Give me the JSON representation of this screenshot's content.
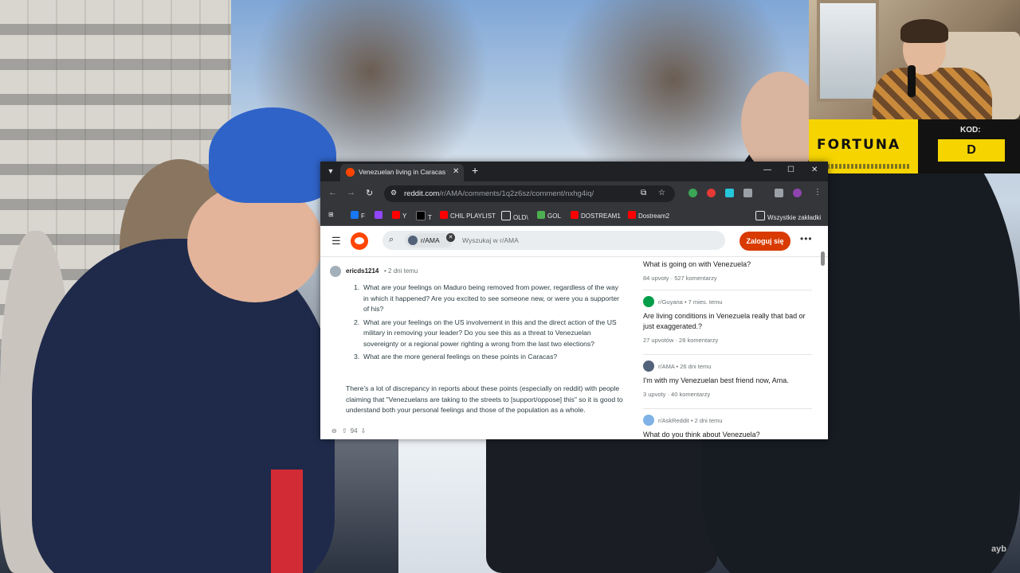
{
  "browser": {
    "tab_title": "Venezuelan living in Caracas th",
    "url_domain": "reddit.com",
    "url_path": "/r/AMA/comments/1q2z6sz/comment/nxhg4iq/",
    "bookmarks": [
      {
        "label": "F",
        "color": "#1877f2"
      },
      {
        "label": "",
        "color": "#9146ff"
      },
      {
        "label": "Y",
        "color": "#ff0000"
      },
      {
        "label": "T",
        "color": "#000000"
      },
      {
        "label": "CHIL PLAYLIST",
        "color": "#ff0000"
      },
      {
        "label": "OLD\\",
        "color": "#e8eaed"
      },
      {
        "label": "GOL",
        "color": "#4caf50"
      },
      {
        "label": "DOSTREAM1",
        "color": "#ff0000"
      },
      {
        "label": "Dostream2",
        "color": "#ff0000"
      }
    ],
    "all_bookmarks": "Wszystkie zakładki"
  },
  "reddit": {
    "subreddit_chip": "r/AMA",
    "search_placeholder": "Wyszukaj w r/AMA",
    "login_label": "Zaloguj się",
    "comment": {
      "author": "ericds1214",
      "time": "• 2 dni temu",
      "list": [
        {
          "n": "1.",
          "text": "What are your feelings on Maduro being removed from power, regardless of the way in which it happened? Are you excited to see someone new, or were you a supporter of his?"
        },
        {
          "n": "2.",
          "text": "What are your feelings on the US involvement in this and the direct action of the US military in removing your leader? Do you see this as a threat to Venezuelan sovereignty or a regional power righting a wrong from the last two elections?"
        },
        {
          "n": "3.",
          "text": "What are the more general feelings on these points in Caracas?"
        }
      ],
      "paragraph": "There's a lot of discrepancy in reports about these points (especially on reddit) with people claiming that \"Venezuelans are taking to the streets to [support/oppose] this\" so it is good to understand both your personal feelings and those of the population as a whole.",
      "votes": "94"
    },
    "related": [
      {
        "sub": "",
        "time": "",
        "title": "What is going on with Venezuela?",
        "upvotes": "84 upvoty",
        "comments": "527 komentarzy",
        "icon_color": ""
      },
      {
        "sub": "r/Guyana",
        "time": "• 7 mies. temu",
        "title": "Are living conditions in Venezuela really that bad or just exaggerated.?",
        "upvotes": "27 upvotów",
        "comments": "28 komentarzy",
        "icon_color": "#009e49"
      },
      {
        "sub": "r/AMA",
        "time": "• 26 dni temu",
        "title": "I'm with my Venezuelan best friend now, Ama.",
        "upvotes": "3 upvoty",
        "comments": "40 komentarzy",
        "icon_color": "#51627a"
      },
      {
        "sub": "r/AskReddit",
        "time": "• 2 dni temu",
        "title": "What do you think about Venezuela?",
        "upvotes": "",
        "comments": "",
        "icon_color": "#7fb2e5"
      }
    ]
  },
  "overlay": {
    "sponsor_brand": "FORTUNA",
    "code_label": "KOD:",
    "code_value": "D",
    "watermark": "ayb"
  }
}
